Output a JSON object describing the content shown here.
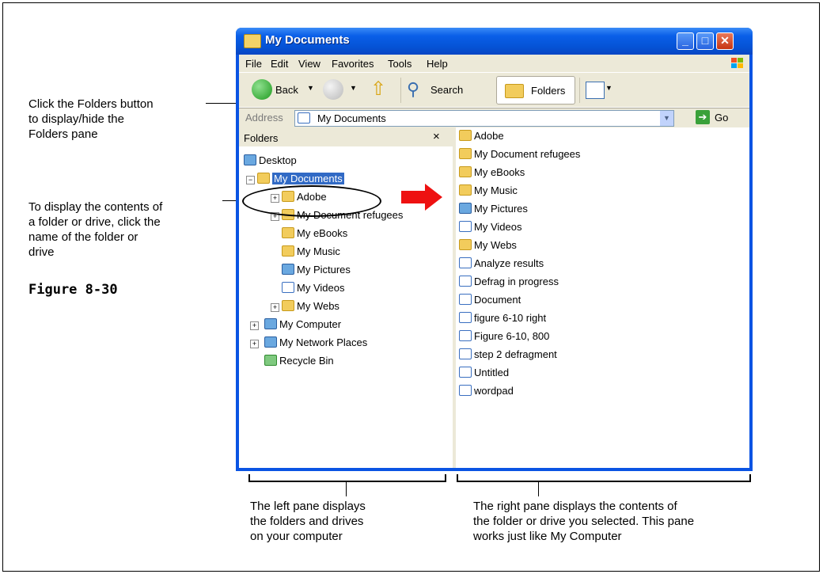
{
  "window": {
    "title": "My Documents",
    "menu": [
      "File",
      "Edit",
      "View",
      "Favorites",
      "Tools",
      "Help"
    ],
    "toolbar": {
      "back": "Back",
      "search": "Search",
      "folders": "Folders"
    },
    "address": {
      "label": "Address",
      "value": "My Documents",
      "go": "Go"
    }
  },
  "left_pane": {
    "title": "Folders",
    "close_glyph": "×",
    "tree": [
      {
        "label": "Desktop",
        "icon": "desktop-icon"
      },
      {
        "label": "My Documents",
        "icon": "my-documents-icon"
      },
      {
        "label": "Adobe",
        "icon": "folder-icon"
      },
      {
        "label": "My Document refugees",
        "icon": "folder-icon"
      },
      {
        "label": "My eBooks",
        "icon": "folder-icon"
      },
      {
        "label": "My Music",
        "icon": "music-folder-icon"
      },
      {
        "label": "My Pictures",
        "icon": "pictures-folder-icon"
      },
      {
        "label": "My Videos",
        "icon": "videos-folder-icon"
      },
      {
        "label": "My Webs",
        "icon": "folder-icon"
      },
      {
        "label": "My Computer",
        "icon": "computer-icon"
      },
      {
        "label": "My Network Places",
        "icon": "network-icon"
      },
      {
        "label": "Recycle Bin",
        "icon": "recycle-bin-icon"
      }
    ]
  },
  "right_pane": {
    "items": [
      "Adobe",
      "My Document refugees",
      "My eBooks",
      "My Music",
      "My Pictures",
      "My Videos",
      "My Webs",
      "Analyze results",
      "Defrag in progress",
      "Document",
      "figure 6-10 right",
      "Figure 6-10, 800",
      "step 2 defragment",
      "Untitled",
      "wordpad"
    ]
  },
  "annotations": {
    "folders_button": [
      "Click the Folders button",
      "to display/hide the",
      "Folders pane"
    ],
    "contents": [
      "To display the contents of",
      "a folder or drive, click the",
      "name of the folder or",
      "drive"
    ],
    "figure": "Figure 8-30",
    "left_pane": [
      "The left pane displays",
      "the folders and drives",
      "on your computer"
    ],
    "right_pane": [
      "The right pane displays the contents of",
      "the folder or drive you selected. This pane",
      "works just like My Computer"
    ]
  },
  "colors": {
    "titlebar": "#0553d6",
    "selection": "#316ac5",
    "arrow": "#ee1111"
  }
}
